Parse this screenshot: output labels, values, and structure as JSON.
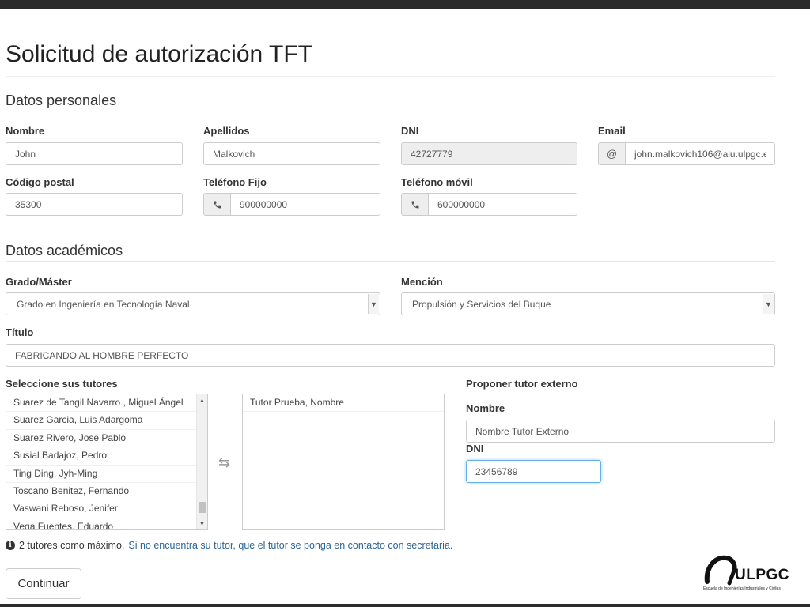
{
  "page_title": "Solicitud de autorización TFT",
  "personal": {
    "section_title": "Datos personales",
    "nombre": {
      "label": "Nombre",
      "value": "John"
    },
    "apellidos": {
      "label": "Apellidos",
      "value": "Malkovich"
    },
    "dni": {
      "label": "DNI",
      "value": "42727779"
    },
    "email": {
      "label": "Email",
      "addon": "@",
      "value": "john.malkovich106@alu.ulpgc.e"
    },
    "cp": {
      "label": "Código postal",
      "value": "35300"
    },
    "fijo": {
      "label": "Teléfono Fijo",
      "value": "900000000"
    },
    "movil": {
      "label": "Teléfono móvil",
      "value": "600000000"
    }
  },
  "academic": {
    "section_title": "Datos académicos",
    "grado": {
      "label": "Grado/Máster",
      "value": "Grado en Ingeniería en Tecnología Naval"
    },
    "mencion": {
      "label": "Mención",
      "value": "Propulsión y Servicios del Buque"
    },
    "titulo": {
      "label": "Título",
      "value": "FABRICANDO AL HOMBRE PERFECTO"
    },
    "tutores_label": "Seleccione sus tutores",
    "available_tutors": [
      "Suarez de Tangil Navarro , Miguel Ángel",
      "Suarez Garcia, Luis Adargoma",
      "Suarez Rivero, José Pablo",
      "Susial Badajoz, Pedro",
      "Ting Ding, Jyh-Ming",
      "Toscano Benitez, Fernando",
      "Vaswani Reboso, Jenifer",
      "Vega Fuentes, Eduardo"
    ],
    "selected_tutors": [
      "Tutor Prueba, Nombre"
    ],
    "external": {
      "heading": "Proponer tutor externo",
      "nombre_label": "Nombre",
      "nombre_value": "Nombre Tutor Externo",
      "dni_label": "DNI",
      "dni_value": "23456789"
    }
  },
  "info": {
    "text": "2 tutores como máximo.",
    "link": "Si no encuentra su tutor, que el tutor se ponga en contacto con secretaria."
  },
  "continue_label": "Continuar",
  "logo": {
    "text": "ULPGC",
    "subtitle": "Escuela de Ingenierías Industriales y Civiles"
  },
  "colors": {
    "link": "#2a6496",
    "focus": "#66afe9",
    "disabled_bg": "#eeeeee"
  }
}
